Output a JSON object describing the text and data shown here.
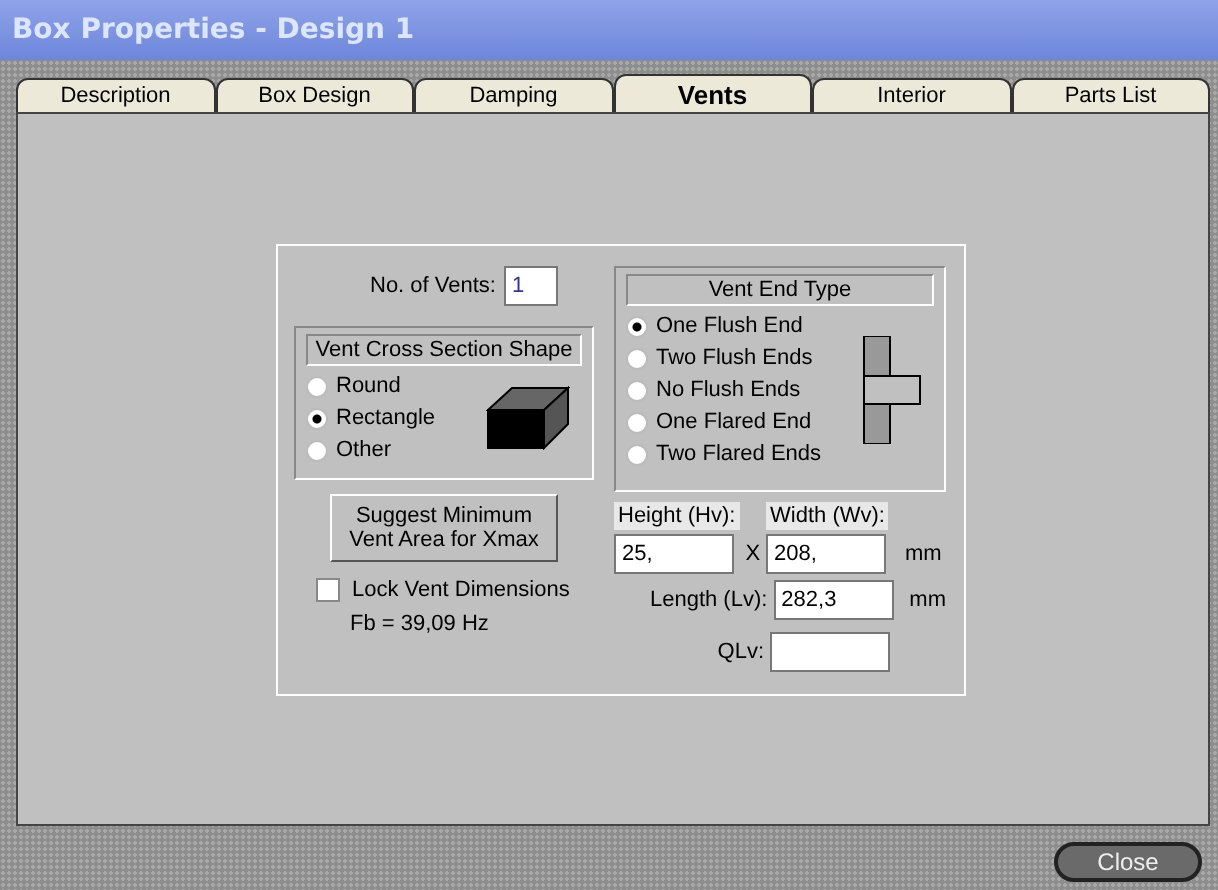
{
  "window": {
    "title": "Box Properties - Design 1"
  },
  "tabs": [
    {
      "label": "Description",
      "selected": false
    },
    {
      "label": "Box Design",
      "selected": false
    },
    {
      "label": "Damping",
      "selected": false
    },
    {
      "label": "Vents",
      "selected": true
    },
    {
      "label": "Interior",
      "selected": false
    },
    {
      "label": "Parts List",
      "selected": false
    }
  ],
  "vents_count": {
    "label": "No. of Vents:",
    "value": "1"
  },
  "cross_section": {
    "title": "Vent Cross Section Shape",
    "options": [
      {
        "label": "Round",
        "selected": false
      },
      {
        "label": "Rectangle",
        "selected": true
      },
      {
        "label": "Other",
        "selected": false
      }
    ]
  },
  "end_type": {
    "title": "Vent End Type",
    "options": [
      {
        "label": "One Flush End",
        "selected": true
      },
      {
        "label": "Two Flush Ends",
        "selected": false
      },
      {
        "label": "No Flush Ends",
        "selected": false
      },
      {
        "label": "One Flared End",
        "selected": false
      },
      {
        "label": "Two Flared Ends",
        "selected": false
      }
    ]
  },
  "suggest_button": {
    "label": "Suggest Minimum Vent Area for Xmax"
  },
  "lock": {
    "label": "Lock Vent Dimensions",
    "checked": false
  },
  "fb": "Fb = 39,09 Hz",
  "height": {
    "label": "Height (Hv):",
    "value": "25,"
  },
  "separator": "X",
  "width": {
    "label": "Width (Wv):",
    "value": "208,",
    "unit": "mm"
  },
  "length": {
    "label": "Length (Lv):",
    "value": "282,3",
    "unit": "mm"
  },
  "qlv": {
    "label": "QLv:"
  },
  "close_button": {
    "label": "Close"
  }
}
